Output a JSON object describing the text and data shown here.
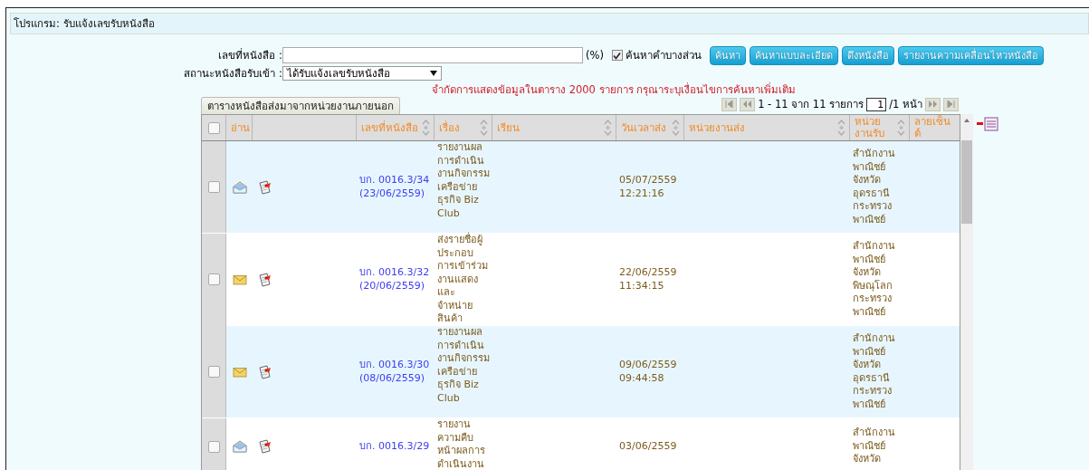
{
  "program_title": "โปรแกรม: รับแจ้งเลขรับหนังสือ",
  "search": {
    "doc_no_label": "เลขที่หนังสือ :",
    "wildcard_hint": "(%)",
    "partial_match": {
      "label": "ค้นหาคำบางส่วน",
      "checked": true
    },
    "status_label": "สถานะหนังสือรับเข้า :",
    "status_value": "ได้รับแจ้งเลขรับหนังสือ"
  },
  "buttons": [
    {
      "label": "ค้นหา"
    },
    {
      "label": "ค้นหาแบบละเอียด"
    },
    {
      "label": "ดึงหนังสือ"
    },
    {
      "label": "รายงานความเคลื่อนไหวหนังสือ"
    }
  ],
  "limit_notice": "จำกัดการแสดงข้อมูลในตาราง 2000 รายการ กรุณาระบุเงื่อนไขการค้นหาเพิ่มเติม",
  "tab": {
    "label": "ตารางหนังสือส่งมาจากหน่วยงานภายนอก",
    "selected": true
  },
  "pager": {
    "summary": "1 - 11 จาก 11 รายการ",
    "page": "1",
    "pages": "/1 หน้า"
  },
  "table": {
    "select_all_checked": false,
    "columns": [
      {
        "kind": "check"
      },
      {
        "kind": "label",
        "label": "อ่าน",
        "sortable": false
      },
      {
        "kind": "blank"
      },
      {
        "kind": "label",
        "label": "เลขที่หนังสือ",
        "sortable": true
      },
      {
        "kind": "label",
        "label": "เรื่อง",
        "sortable": true
      },
      {
        "kind": "label",
        "label": "เรียน",
        "sortable": true
      },
      {
        "kind": "label",
        "label": "วันเวลาส่ง",
        "sortable": true
      },
      {
        "kind": "label",
        "label": "หน่วยงานส่ง",
        "sortable": true
      },
      {
        "kind": "label",
        "label": "หน่วยงานรับ",
        "sortable": true
      },
      {
        "kind": "label",
        "label": "ลายเซ็นต์",
        "sortable": false
      }
    ],
    "rows": [
      {
        "checked": false,
        "read": true,
        "doc_no": "บก. 0016.3/34 (23/06/2559)",
        "subject": "รายงานผลการดำเนินงานกิจกรรมเครือข่ายธุรกิจ Biz Club",
        "sent": "05/07/2559 12:21:16",
        "receiver": "สำนักงานพาณิชย์จังหวัดอุดรธานีกระทรวงพาณิชย์"
      },
      {
        "checked": false,
        "read": false,
        "doc_no": "บก. 0016.3/32 (20/06/2559)",
        "subject": "ส่งรายชื่อผู้ประกอบการเข้าร่วมงานแสดงและจำหน่ายสินค้า",
        "sent": "22/06/2559 11:34:15",
        "receiver": "สำนักงานพาณิชย์จังหวัดพิษณุโลกกระทรวงพาณิชย์"
      },
      {
        "checked": false,
        "read": false,
        "doc_no": "บก. 0016.3/30 (08/06/2559)",
        "subject": "รายงานผลการดำเนินงานกิจกรรมเครือข่ายธุรกิจ Biz Club",
        "sent": "09/06/2559 09:44:58",
        "receiver": "สำนักงานพาณิชย์จังหวัดอุดรธานีกระทรวงพาณิชย์"
      },
      {
        "checked": false,
        "read": true,
        "doc_no": "บก. 0016.3/29",
        "subject": "รายงานความคืบหน้าผลการดำเนินงาน",
        "sent": "03/06/2559",
        "receiver": "สำนักงานพาณิชย์จังหวัด"
      }
    ]
  }
}
